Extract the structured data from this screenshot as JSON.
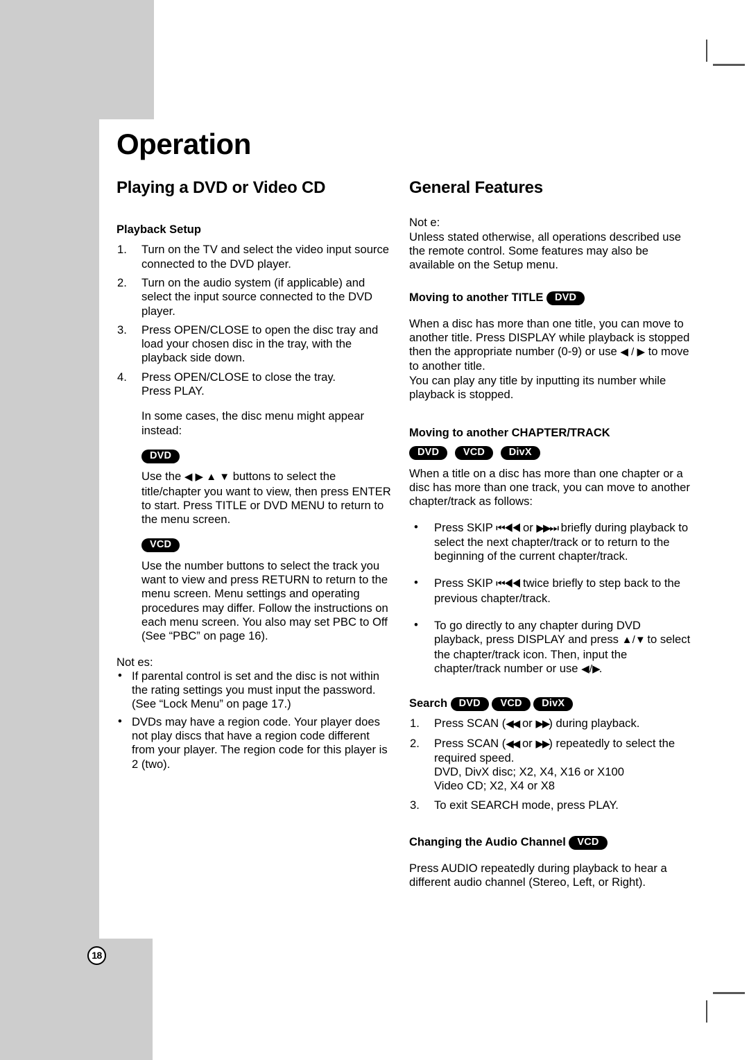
{
  "page": {
    "number": "18",
    "chapter_title": "Operation",
    "background_grey": "#cdcdcd"
  },
  "left_column": {
    "section_title": "Playing a DVD or Video CD",
    "sub_title": "Playback Setup",
    "steps": [
      {
        "num": "1.",
        "text": "Turn on the TV and select the video input source connected to the DVD player."
      },
      {
        "num": "2.",
        "text": "Turn on the audio system (if applicable) and select the input source connected to the DVD player."
      },
      {
        "num": "3.",
        "text": "Press OPEN/CLOSE to open the disc tray and load your chosen disc in the tray, with the playback side down."
      },
      {
        "num": "4.",
        "text": "Press OPEN/CLOSE to close the tray.\nPress PLAY."
      }
    ],
    "disc_menu_note": "In some cases, the disc menu might appear instead:",
    "dvd_badge": "DVD",
    "dvd_text_before": "Use the ",
    "dvd_glyphs": "◀ ▶ ▲ ▼",
    "dvd_text_after": " buttons to select the title/chapter you want to view, then press ENTER to start. Press TITLE or DVD MENU to return to the menu screen.",
    "vcd_badge": "VCD",
    "vcd_text": "Use the number buttons to select the track you want to view and press RETURN to return to the menu screen. Menu settings and operating procedures may differ. Follow the instructions on each menu screen. You also may set PBC to Off (See “PBC” on page 16).",
    "notes_label": "Not es:",
    "notes": [
      "If parental control is set and the disc is not within the rating settings you must input the password. (See “Lock Menu” on page 17.)",
      "DVDs may have a region code. Your player does not play discs that have a region code different from your player. The region code for this player is 2 (two)."
    ]
  },
  "right_column": {
    "section_title": "General Features",
    "note_label": "Not e:",
    "note_text": "Unless stated otherwise, all operations described use the remote control. Some features may also be available on the Setup menu.",
    "title_section": {
      "heading": "Moving to another TITLE",
      "badges": [
        "DVD"
      ],
      "line1": "When a disc has more than one title, you can move to another title. Press DISPLAY while playback is stopped then the appropriate number (0-9) or use",
      "line2_glyphs": "◀ / ▶",
      "line2_text": " to move to another title.",
      "line3": "You can play any title by inputting its number while playback is stopped."
    },
    "chapter_section": {
      "heading": "Moving to another CHAPTER/TRACK",
      "badges": [
        "DVD",
        "VCD",
        "DivX"
      ],
      "intro": "When a title on a disc has more than one chapter or a disc has more than one track, you can move to another chapter/track as follows:",
      "bullets": [
        {
          "parts": [
            {
              "t": "text",
              "v": "Press SKIP "
            },
            {
              "t": "glyph",
              "v": "⏮◀◀"
            },
            {
              "t": "text",
              "v": " or "
            },
            {
              "t": "glyph",
              "v": "▶▶⏭"
            },
            {
              "t": "text",
              "v": " briefly during playback to select the next chapter/track or to return to the beginning of the current chapter/track."
            }
          ]
        },
        {
          "parts": [
            {
              "t": "text",
              "v": "Press SKIP "
            },
            {
              "t": "glyph",
              "v": "⏮◀◀"
            },
            {
              "t": "text",
              "v": " twice briefly to step back to the previous chapter/track."
            }
          ]
        },
        {
          "parts": [
            {
              "t": "text",
              "v": "To go directly to any chapter during DVD playback, press DISPLAY and press "
            },
            {
              "t": "glyph",
              "v": "▲ / ▼"
            },
            {
              "t": "text",
              "v": " to select the chapter/track icon. Then, input the chapter/track number or use "
            },
            {
              "t": "glyph",
              "v": "◀ / ▶"
            },
            {
              "t": "text",
              "v": "."
            }
          ]
        }
      ]
    },
    "search_section": {
      "heading": "Search",
      "badges": [
        "DVD",
        "VCD",
        "DivX"
      ],
      "steps": [
        {
          "num": "1.",
          "parts": [
            {
              "t": "text",
              "v": "Press SCAN ("
            },
            {
              "t": "glyph",
              "v": "◀◀"
            },
            {
              "t": "text",
              "v": " or "
            },
            {
              "t": "glyph",
              "v": "▶▶"
            },
            {
              "t": "text",
              "v": ") during playback."
            }
          ]
        },
        {
          "num": "2.",
          "parts": [
            {
              "t": "text",
              "v": "Press SCAN ("
            },
            {
              "t": "glyph",
              "v": "◀◀"
            },
            {
              "t": "text",
              "v": " or "
            },
            {
              "t": "glyph",
              "v": "▶▶"
            },
            {
              "t": "text",
              "v": ") repeatedly to select the required speed.\nDVD, DivX disc; X2, X4, X16 or X100\nVideo CD; X2, X4 or X8"
            }
          ]
        },
        {
          "num": "3.",
          "parts": [
            {
              "t": "text",
              "v": "To exit SEARCH mode, press PLAY."
            }
          ]
        }
      ]
    },
    "audio_section": {
      "heading": "Changing the Audio Channel",
      "badges": [
        "VCD"
      ],
      "text": "Press AUDIO repeatedly during playback to hear a different audio channel (Stereo, Left, or Right)."
    }
  }
}
